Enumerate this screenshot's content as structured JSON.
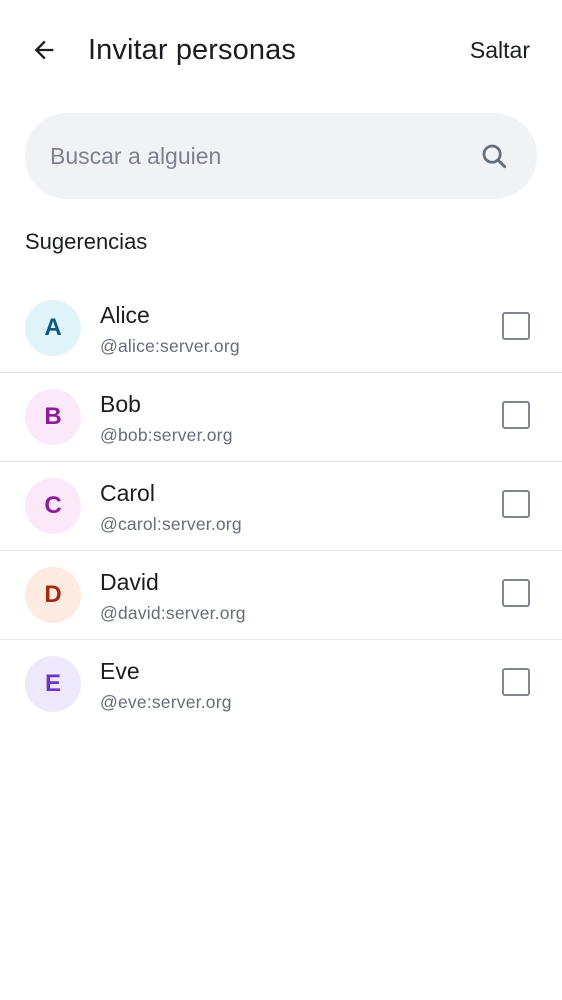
{
  "header": {
    "title": "Invitar personas",
    "skip_label": "Saltar",
    "back_icon": "arrow-left-icon"
  },
  "search": {
    "placeholder": "Buscar a alguien",
    "value": "",
    "icon": "search-icon"
  },
  "suggestions": {
    "title": "Sugerencias",
    "items": [
      {
        "initial": "A",
        "name": "Alice",
        "handle": "@alice:server.org",
        "avatar_bg": "#e0f3f8",
        "avatar_fg": "#0a5a80",
        "checked": false
      },
      {
        "initial": "B",
        "name": "Bob",
        "handle": "@bob:server.org",
        "avatar_bg": "#fbe8f8",
        "avatar_fg": "#8e1d9a",
        "checked": false
      },
      {
        "initial": "C",
        "name": "Carol",
        "handle": "@carol:server.org",
        "avatar_bg": "#fbe8f8",
        "avatar_fg": "#8e1d9a",
        "checked": false
      },
      {
        "initial": "D",
        "name": "David",
        "handle": "@david:server.org",
        "avatar_bg": "#fdebe2",
        "avatar_fg": "#a12c0f",
        "checked": false
      },
      {
        "initial": "E",
        "name": "Eve",
        "handle": "@eve:server.org",
        "avatar_bg": "#eee8fd",
        "avatar_fg": "#6a35c9",
        "checked": false
      }
    ]
  }
}
